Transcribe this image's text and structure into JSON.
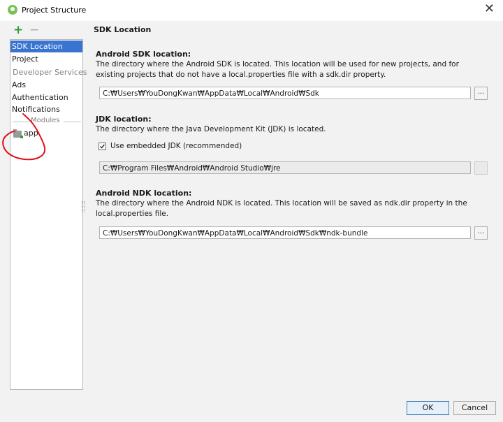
{
  "window": {
    "title": "Project Structure",
    "close_glyph": "✕"
  },
  "toolbar": {
    "add_glyph": "+",
    "remove_glyph": "−"
  },
  "sidebar": {
    "items": [
      {
        "label": "SDK Location",
        "selected": true
      },
      {
        "label": "Project"
      },
      {
        "label": "Developer Services",
        "group_header": true
      },
      {
        "label": "Ads"
      },
      {
        "label": "Authentication"
      },
      {
        "label": "Notifications"
      }
    ],
    "modules_header": "Modules",
    "modules": [
      {
        "label": "app",
        "icon": "module-folder-icon"
      }
    ]
  },
  "main": {
    "page_title": "SDK Location",
    "sdk": {
      "title": "Android SDK location:",
      "description": "The directory where the Android SDK is located. This location will be used for new projects, and for existing projects that do not have a local.properties file with a sdk.dir property.",
      "path": "C:₩Users₩YouDongKwan₩AppData₩Local₩Android₩Sdk"
    },
    "jdk": {
      "title": "JDK location:",
      "description": "The directory where the Java Development Kit (JDK) is located.",
      "checkbox_label": "Use embedded JDK (recommended)",
      "checkbox_checked": true,
      "check_glyph": "✓",
      "path": "C:₩Program Files₩Android₩Android Studio₩jre"
    },
    "ndk": {
      "title": "Android NDK location:",
      "description": "The directory where the Android NDK is located. This location will be saved as ndk.dir property in the local.properties file.",
      "path": "C:₩Users₩YouDongKwan₩AppData₩Local₩Android₩Sdk₩ndk-bundle"
    },
    "browse_label": "..."
  },
  "footer": {
    "ok_label": "OK",
    "cancel_label": "Cancel"
  },
  "colors": {
    "selection": "#3874d0",
    "annotation": "#e0101a",
    "add_icon": "#2d9e35"
  }
}
